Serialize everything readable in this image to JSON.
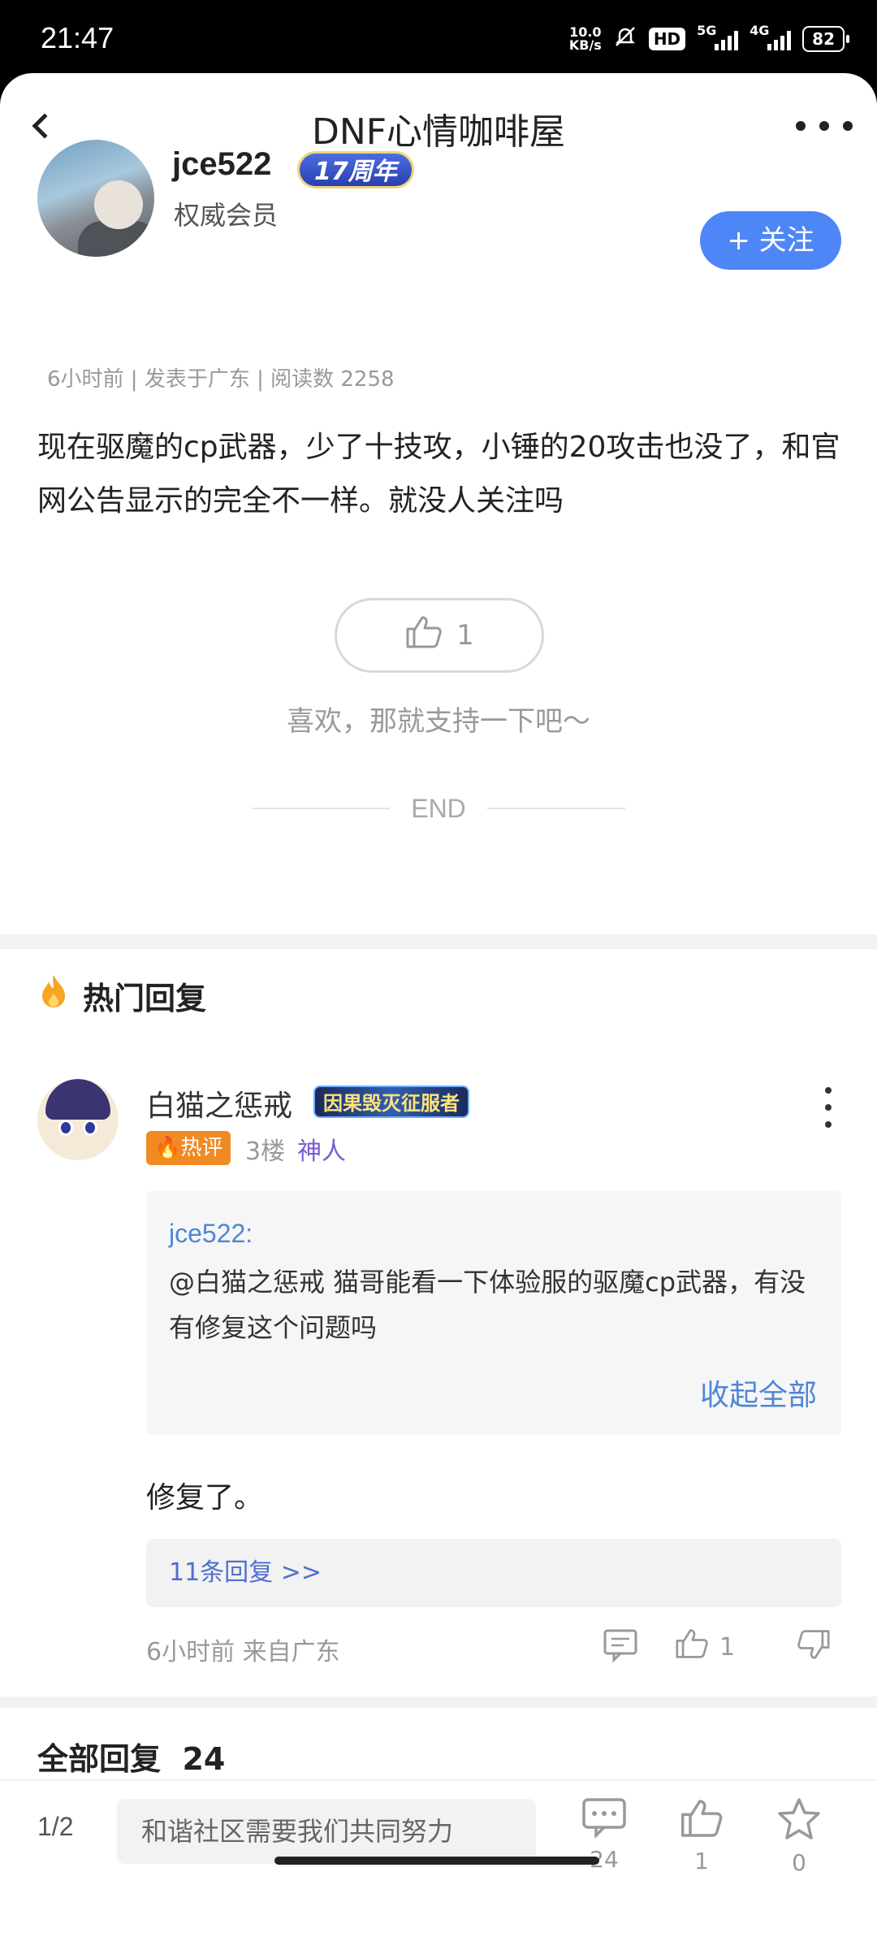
{
  "status_bar": {
    "time": "21:47",
    "net_speed": "10.0\nKB/s",
    "hd_label": "HD",
    "signal1_label": "5G",
    "signal2_label": "4G",
    "battery": "82"
  },
  "nav": {
    "title": "DNF心情咖啡屋"
  },
  "author": {
    "name": "jce522",
    "badge": "17周年",
    "level": "权威会员",
    "follow_label": "+ 关注"
  },
  "post": {
    "meta": "6小时前 | 发表于广东 | 阅读数 2258",
    "body": "现在驱魔的cp武器，少了十技攻，小锤的20攻击也没了，和官网公告显示的完全不一样。就没人关注吗",
    "like_count": "1",
    "like_hint": "喜欢，那就支持一下吧～",
    "end_label": "END"
  },
  "hot_replies": {
    "title": "热门回复",
    "items": [
      {
        "user": "白猫之惩戒",
        "medal": "因果毁灭征服者",
        "hot_tag": "热评",
        "floor": "3楼",
        "user_title": "神人",
        "quote_author": "jce522:",
        "quote_text": "@白猫之惩戒 猫哥能看一下体验服的驱魔cp武器，有没有修复这个问题吗",
        "collapse_label": "收起全部",
        "text": "修复了。",
        "subreplies_label": "11条回复 >>",
        "time": "6小时前 来自广东",
        "like_count": "1"
      }
    ]
  },
  "all_replies": {
    "label": "全部回复",
    "count": "24"
  },
  "bottom_bar": {
    "page": "1/2",
    "input_placeholder": "和谐社区需要我们共同努力",
    "comment_count": "24",
    "like_count": "1",
    "favorite_count": "0"
  },
  "colors": {
    "accent_blue": "#4f86f7",
    "link_blue": "#4f86d6",
    "hot_orange": "#f08a24",
    "title_purple": "#7a5bd0"
  }
}
